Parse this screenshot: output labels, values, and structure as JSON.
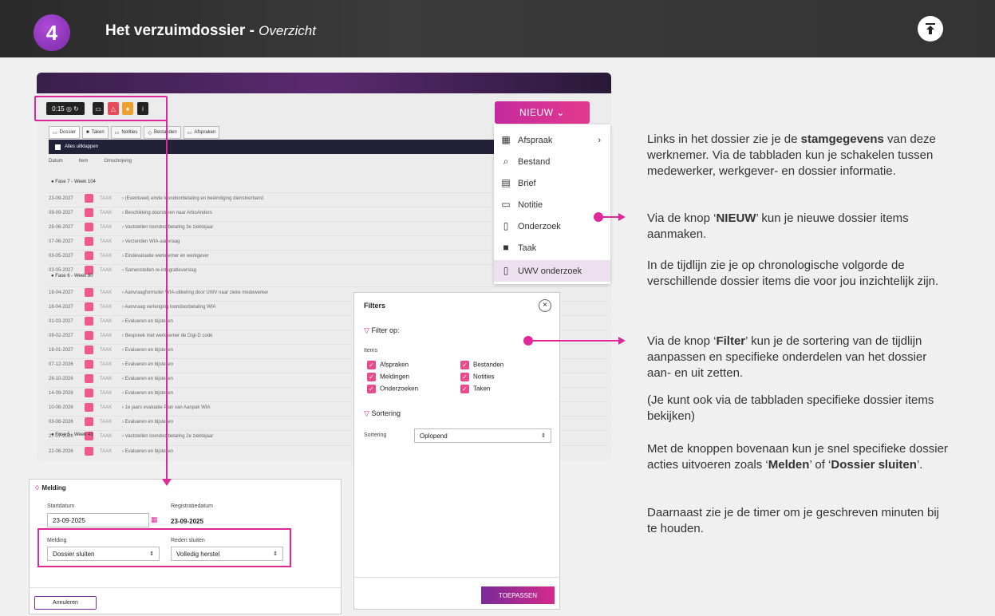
{
  "header": {
    "step": "4",
    "title": "Het verzuimdossier - ",
    "subtitle": "Overzicht"
  },
  "screen": {
    "timer": "0:15",
    "tabs": [
      "Dossier",
      "Taken",
      "Notities",
      "Bestanden",
      "Afspraken"
    ],
    "alles": "Alles uitklappen",
    "cols": [
      "Datum",
      "Item",
      "Omschrijving"
    ],
    "fase7": "Fase 7 - Week 104",
    "fase6": "Fase 6 - Week 80",
    "fase5": "Fase 5 - Week 43",
    "rows7": [
      {
        "d": "23-09-2027",
        "t": "TAAK",
        "o": "(Eventueel) einde loondoorbetaling en beëindiging dienstverband"
      },
      {
        "d": "09-09-2027",
        "t": "TAAK",
        "o": "Beschikking doorsturen naar ArboAnders"
      },
      {
        "d": "28-06-2027",
        "t": "TAAK",
        "o": "Vaststellen loondoorbetaling 3e ziektejaar"
      },
      {
        "d": "07-06-2027",
        "t": "TAAK",
        "o": "Verzenden WIA-aanvraag"
      },
      {
        "d": "03-05-2027",
        "t": "TAAK",
        "o": "Eindevaluatie werknemer en werkgever"
      },
      {
        "d": "03-05-2027",
        "t": "TAAK",
        "o": "Samenstellen re-integratieverslag"
      }
    ],
    "rows6": [
      {
        "d": "18-04-2027",
        "t": "TAAK",
        "o": "Aanvraagformulier WIA-uitkering door UWV naar zieke medewerker"
      },
      {
        "d": "18-04-2027",
        "t": "TAAK",
        "o": "Aanvraag verlenging loondoorbetaling WIA"
      },
      {
        "d": "01-03-2027",
        "t": "TAAK",
        "o": "Evalueren en bijstellen"
      },
      {
        "d": "09-02-2027",
        "t": "TAAK",
        "o": "Bespreek met werknemer de Digi-D code"
      },
      {
        "d": "18-01-2027",
        "t": "TAAK",
        "o": "Evalueren en bijstellen"
      },
      {
        "d": "07-12-2026",
        "t": "TAAK",
        "o": "Evalueren en bijstellen"
      },
      {
        "d": "26-10-2026",
        "t": "TAAK",
        "o": "Evalueren en bijstellen"
      },
      {
        "d": "14-09-2026",
        "t": "TAAK",
        "o": "Evalueren en bijstellen"
      },
      {
        "d": "10-08-2026",
        "t": "TAAK",
        "o": "1e jaars evaluatie Plan van Aanpak WIA"
      },
      {
        "d": "03-08-2026",
        "t": "TAAK",
        "o": "Evalueren en bijstellen"
      },
      {
        "d": "27-07-2026",
        "t": "TAAK",
        "o": "Vaststellen loondoorbetaling 2e ziektejaar"
      }
    ],
    "rows5": [
      {
        "d": "22-06-2026",
        "t": "TAAK",
        "o": "Evalueren en bijstellen"
      }
    ]
  },
  "nieuw": {
    "label": "NIEUW ⌄",
    "items": [
      "Afspraak",
      "Bestand",
      "Brief",
      "Notitie",
      "Onderzoek",
      "Taak",
      "UWV onderzoek"
    ]
  },
  "filter": {
    "title": "Filters",
    "filter_op": "Filter op:",
    "items_label": "Items",
    "left": [
      "Afspraken",
      "Meldingen",
      "Onderzoeken"
    ],
    "right": [
      "Bestanden",
      "Notities",
      "Taken"
    ],
    "sortering_head": "Sortering",
    "sortering_label": "Sortering",
    "sortering_value": "Oplopend",
    "apply": "TOEPASSEN"
  },
  "melding": {
    "title": "Melding",
    "startdatum": "Startdatum",
    "startvalue": "23-09-2025",
    "registratie": "Registratiedatum",
    "regvalue": "23-09-2025",
    "melding": "Melding",
    "meldingvalue": "Dossier sluiten",
    "reden": "Reden sluiten",
    "redenvalue": "Volledig herstel",
    "cancel": "Annuleren"
  },
  "text": {
    "p1a": "Links in het dossier zie je de ",
    "p1b": "stamgegevens",
    "p1c": " van deze werknemer. Via de tabbladen kun je schakelen tussen medewerker, werkgever- en dossier informatie.",
    "p2a": "Via de knop ‘",
    "p2b": "NIEUW",
    "p2c": "’ kun je nieuwe dossier items aanmaken.",
    "p3": "In de tijdlijn zie je op chronologische volgorde de verschillende dossier items die voor jou inzichtelijk zijn.",
    "p4a": "Via de knop ‘",
    "p4b": "Filter",
    "p4c": "’ kun je de sortering van de tijdlijn aanpassen en specifieke onderdelen van het dossier aan- en uit zetten.",
    "p5": "(Je kunt ook via de tabbladen specifieke dossier items bekijken)",
    "p6a": "Met de knoppen bovenaan kun je snel specifieke dossier acties uitvoeren zoals ‘",
    "p6b": "Melden",
    "p6c": "’ of ‘",
    "p6d": "Dossier sluiten",
    "p6e": "’.",
    "p7": "Daarnaast zie je de timer om je geschreven minuten bij te houden."
  }
}
